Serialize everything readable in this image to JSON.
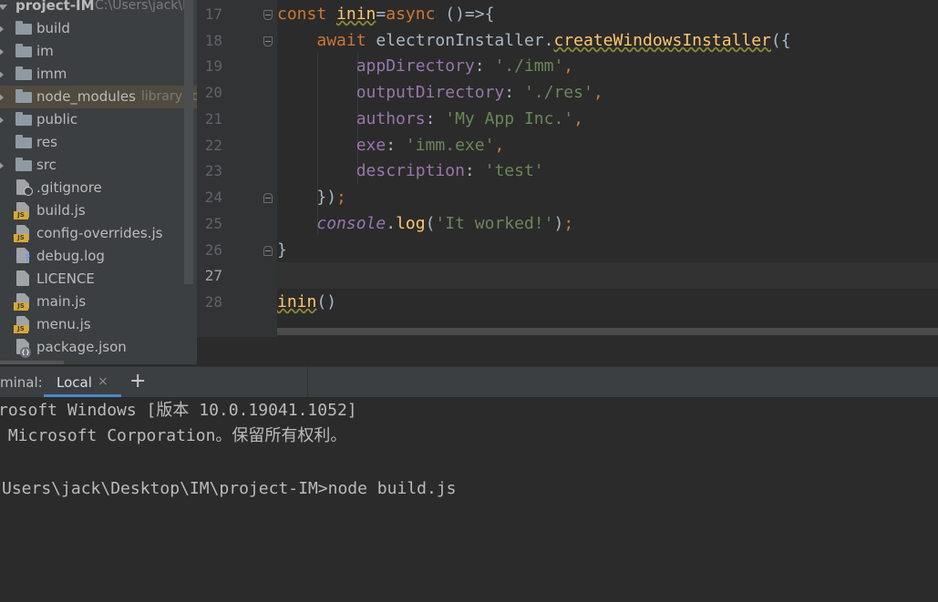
{
  "project": {
    "name": "project-IM",
    "path": "C:\\Users\\jack\\D"
  },
  "tree": [
    {
      "name": "build",
      "kind": "folder",
      "icon": "folder-icon"
    },
    {
      "name": "im",
      "kind": "folder",
      "icon": "folder-icon"
    },
    {
      "name": "imm",
      "kind": "folder",
      "icon": "folder-icon"
    },
    {
      "name": "node_modules",
      "kind": "folder",
      "icon": "folder-icon",
      "hint": "library ro",
      "highlighted": true
    },
    {
      "name": "public",
      "kind": "folder",
      "icon": "folder-icon"
    },
    {
      "name": "res",
      "kind": "folder",
      "icon": "folder-icon"
    },
    {
      "name": "src",
      "kind": "folder",
      "icon": "folder-icon"
    },
    {
      "name": ".gitignore",
      "kind": "file",
      "icon": "gitignore-file-icon"
    },
    {
      "name": "build.js",
      "kind": "file",
      "icon": "js-file-icon"
    },
    {
      "name": "config-overrides.js",
      "kind": "file",
      "icon": "js-file-icon"
    },
    {
      "name": "debug.log",
      "kind": "file",
      "icon": "unknown-file-icon"
    },
    {
      "name": "LICENCE",
      "kind": "file",
      "icon": "text-file-icon"
    },
    {
      "name": "main.js",
      "kind": "file",
      "icon": "js-file-icon"
    },
    {
      "name": "menu.js",
      "kind": "file",
      "icon": "js-file-icon"
    },
    {
      "name": "package.json",
      "kind": "file",
      "icon": "json-file-icon"
    }
  ],
  "editor": {
    "current_line": "27",
    "lines": [
      {
        "number": "17"
      },
      {
        "number": "18"
      },
      {
        "number": "19"
      },
      {
        "number": "20"
      },
      {
        "number": "21"
      },
      {
        "number": "22"
      },
      {
        "number": "23"
      },
      {
        "number": "24"
      },
      {
        "number": "25"
      },
      {
        "number": "26"
      },
      {
        "number": "27"
      },
      {
        "number": "28"
      }
    ],
    "tokens": {
      "l17_kw": "const",
      "l17_fn": "inin",
      "l17_eq": "=",
      "l17_async": "async",
      "l17_rest": " ()=>{",
      "l18_await": "await",
      "l18_obj": "electronInstaller",
      "l18_dot": ".",
      "l18_meth": "createWindowsInstaller",
      "l18_paren": "({",
      "l19_prop": "appDirectory",
      "l19_colon": ": ",
      "l19_str": "'./imm'",
      "l19_comma": ",",
      "l20_prop": "outputDirectory",
      "l20_colon": ": ",
      "l20_str": "'./res'",
      "l20_comma": ",",
      "l21_prop": "authors",
      "l21_colon": ": ",
      "l21_str": "'My App Inc.'",
      "l21_comma": ",",
      "l22_prop": "exe",
      "l22_colon": ": ",
      "l22_str": "'imm.exe'",
      "l22_comma": ",",
      "l23_prop": "description",
      "l23_colon": ": ",
      "l23_str": "'test'",
      "l24_close": "})",
      "l24_semi": ";",
      "l25_obj": "console",
      "l25_dot": ".",
      "l25_meth": "log",
      "l25_open": "(",
      "l25_str": "'It worked!'",
      "l25_close": ")",
      "l25_semi": ";",
      "l26_close": "}",
      "l28_fn": "inin",
      "l28_call": "()"
    }
  },
  "terminal": {
    "title": "minal:",
    "tab_label": "Local",
    "tab_close": "×",
    "add_tab": "+",
    "output": [
      "rosoft Windows [版本 10.0.19041.1052]",
      " Microsoft Corporation。保留所有权利。",
      "",
      "Users\\jack\\Desktop\\IM\\project-IM>node build.js"
    ]
  },
  "colors": {
    "keyword": "#cc7832",
    "function": "#ffc66d",
    "property": "#9876aa",
    "string": "#6a8759",
    "plain": "#a9b7c6",
    "tab_underline": "#4a88c7"
  }
}
